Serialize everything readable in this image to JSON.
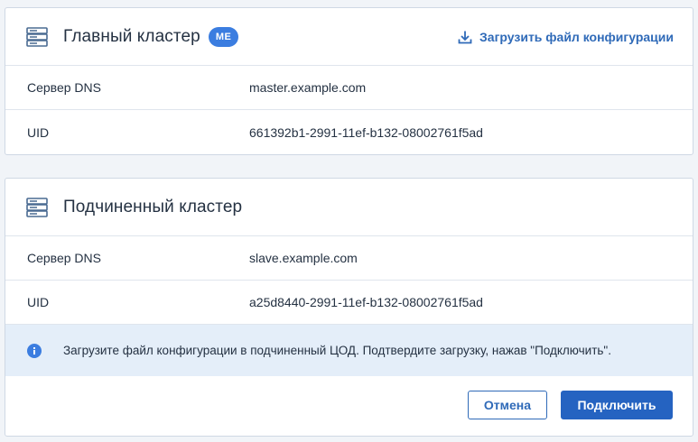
{
  "colors": {
    "accent": "#2f6ab8",
    "primary_button": "#2563c1",
    "badge": "#3b7de0",
    "info_banner_bg": "#e4eef9",
    "info_icon": "#3b7de0"
  },
  "master": {
    "icon": "server-icon",
    "title": "Главный кластер",
    "badge": "ME",
    "download_icon": "download-icon",
    "download_label": "Загрузить файл конфигурации",
    "rows": [
      {
        "label": "Сервер DNS",
        "value": "master.example.com"
      },
      {
        "label": "UID",
        "value": "661392b1-2991-11ef-b132-08002761f5ad"
      }
    ]
  },
  "slave": {
    "icon": "server-icon",
    "title": "Подчиненный кластер",
    "rows": [
      {
        "label": "Сервер DNS",
        "value": "slave.example.com"
      },
      {
        "label": "UID",
        "value": "a25d8440-2991-11ef-b132-08002761f5ad"
      }
    ],
    "info_icon": "info-icon",
    "info_text": "Загрузите файл конфигурации в подчиненный ЦОД. Подтвердите загрузку, нажав \"Подключить\".",
    "cancel_label": "Отмена",
    "connect_label": "Подключить"
  }
}
